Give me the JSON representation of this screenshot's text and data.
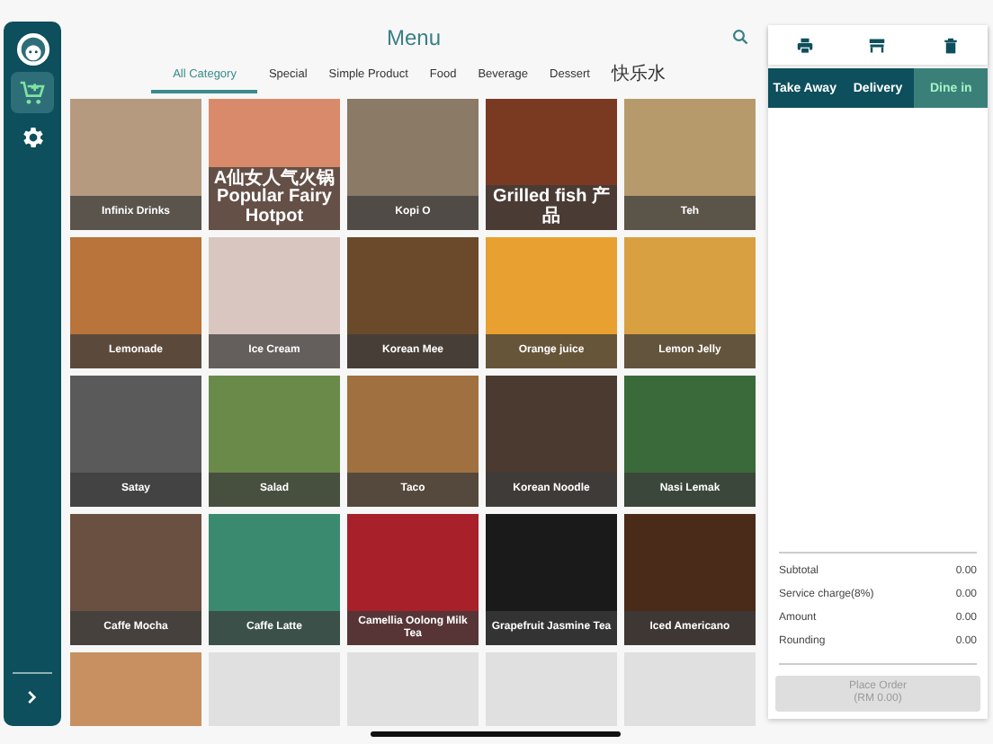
{
  "sidebar": {
    "items": [
      {
        "kind": "cart",
        "selected": true
      },
      {
        "kind": "settings",
        "selected": false
      }
    ]
  },
  "menu": {
    "title": "Menu",
    "tabs": [
      {
        "label": "All Category",
        "selected": true
      },
      {
        "label": "Special",
        "selected": false
      },
      {
        "label": "Simple Product",
        "selected": false
      },
      {
        "label": "Food",
        "selected": false
      },
      {
        "label": "Beverage",
        "selected": false
      },
      {
        "label": "Dessert",
        "selected": false
      },
      {
        "label": "快乐水",
        "selected": false
      }
    ],
    "items": [
      {
        "kind": "item",
        "name": "Infinix Drinks"
      },
      {
        "kind": "item",
        "name": "A仙女人气火锅 Popular Fairy Hotpot"
      },
      {
        "kind": "item",
        "name": "Kopi O"
      },
      {
        "kind": "item",
        "name": "Grilled fish 产品"
      },
      {
        "kind": "item",
        "name": "Teh"
      },
      {
        "kind": "item",
        "name": "Lemonade"
      },
      {
        "kind": "item",
        "name": "Ice Cream"
      },
      {
        "kind": "item",
        "name": "Korean Mee"
      },
      {
        "kind": "item",
        "name": "Orange juice"
      },
      {
        "kind": "item",
        "name": "Lemon Jelly"
      },
      {
        "kind": "item",
        "name": "Satay"
      },
      {
        "kind": "item",
        "name": "Salad"
      },
      {
        "kind": "item",
        "name": "Taco"
      },
      {
        "kind": "item",
        "name": "Korean Noodle"
      },
      {
        "kind": "item",
        "name": "Nasi Lemak"
      },
      {
        "kind": "item",
        "name": "Caffe Mocha"
      },
      {
        "kind": "item",
        "name": "Caffe Latte"
      },
      {
        "kind": "item",
        "name": "Camellia Oolong Milk Tea"
      },
      {
        "kind": "item",
        "name": "Grapefruit Jasmine Tea"
      },
      {
        "kind": "item",
        "name": "Iced Americano"
      },
      {
        "kind": "photo"
      },
      {
        "kind": "empty"
      },
      {
        "kind": "empty"
      },
      {
        "kind": "empty"
      },
      {
        "kind": "empty"
      }
    ]
  },
  "order": {
    "order_types": [
      {
        "label": "Take Away",
        "selected": false
      },
      {
        "label": "Delivery",
        "selected": false
      },
      {
        "label": "Dine in",
        "selected": true
      }
    ],
    "summary": [
      {
        "label": "Subtotal",
        "value": "0.00"
      },
      {
        "label": "Service charge(8%)",
        "value": "0.00"
      },
      {
        "label": "Amount",
        "value": "0.00"
      },
      {
        "label": "Rounding",
        "value": "0.00"
      }
    ],
    "place_order": {
      "label": "Place Order",
      "amount": "(RM 0.00)",
      "disabled": true
    }
  }
}
